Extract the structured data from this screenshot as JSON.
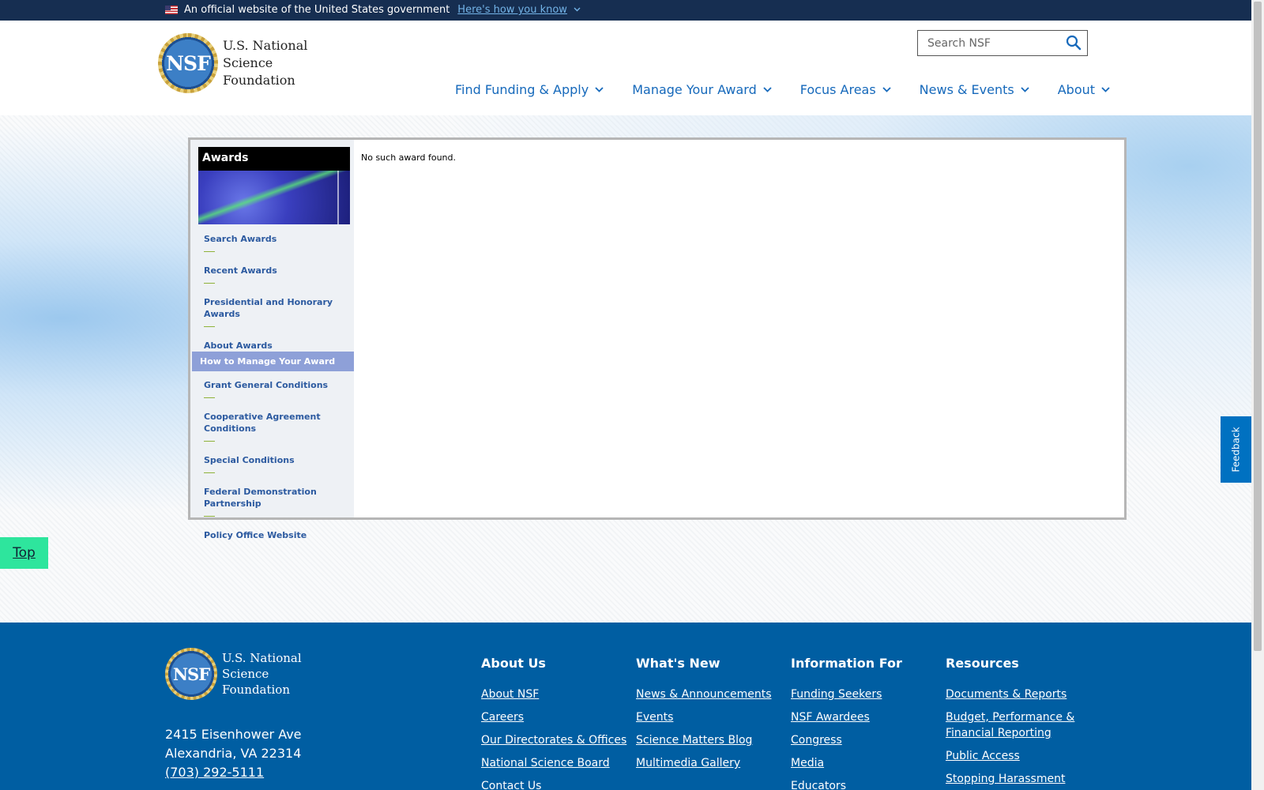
{
  "gov_banner": {
    "text": "An official website of the United States government",
    "link": "Here's how you know"
  },
  "header": {
    "logo_seal": "NSF",
    "logo_lines": [
      "U.S. National",
      "Science",
      "Foundation"
    ],
    "search_placeholder": "Search NSF",
    "nav": [
      "Find Funding & Apply",
      "Manage Your Award",
      "Focus Areas",
      "News & Events",
      "About"
    ]
  },
  "sidebar": {
    "title": "Awards",
    "items": [
      "Search Awards",
      "Recent Awards",
      "Presidential and Honorary Awards",
      "About Awards",
      "How to Manage Your Award",
      "Grant General Conditions",
      "Cooperative Agreement Conditions",
      "Special Conditions",
      "Federal Demonstration Partnership",
      "Policy Office Website"
    ],
    "active_item": "How to Manage Your Award"
  },
  "main": {
    "message": "No such award found."
  },
  "top_button": "Top",
  "feedback": "Feedback",
  "footer": {
    "logo_seal": "NSF",
    "logo_lines": [
      "U.S. National",
      "Science",
      "Foundation"
    ],
    "address_lines": [
      "2415 Eisenhower Ave",
      "Alexandria, VA 22314"
    ],
    "phone": "(703) 292-5111",
    "columns": [
      {
        "heading": "About Us",
        "links": [
          "About NSF",
          "Careers",
          "Our Directorates & Offices",
          "National Science Board",
          "Contact Us"
        ]
      },
      {
        "heading": "What's New",
        "links": [
          "News & Announcements",
          "Events",
          "Science Matters Blog",
          "Multimedia Gallery"
        ]
      },
      {
        "heading": "Information For",
        "links": [
          "Funding Seekers",
          "NSF Awardees",
          "Congress",
          "Media",
          "Educators"
        ]
      },
      {
        "heading": "Resources",
        "links": [
          "Documents & Reports",
          "Budget, Performance & Financial Reporting",
          "Public Access",
          "Stopping Harassment"
        ]
      }
    ]
  },
  "colors": {
    "gov_banner_bg": "#162e51",
    "nav_link": "#1669bb",
    "footer_bg": "#005ea2",
    "top_button_bg": "#2ee59d",
    "feedback_bg": "#0071c1"
  }
}
